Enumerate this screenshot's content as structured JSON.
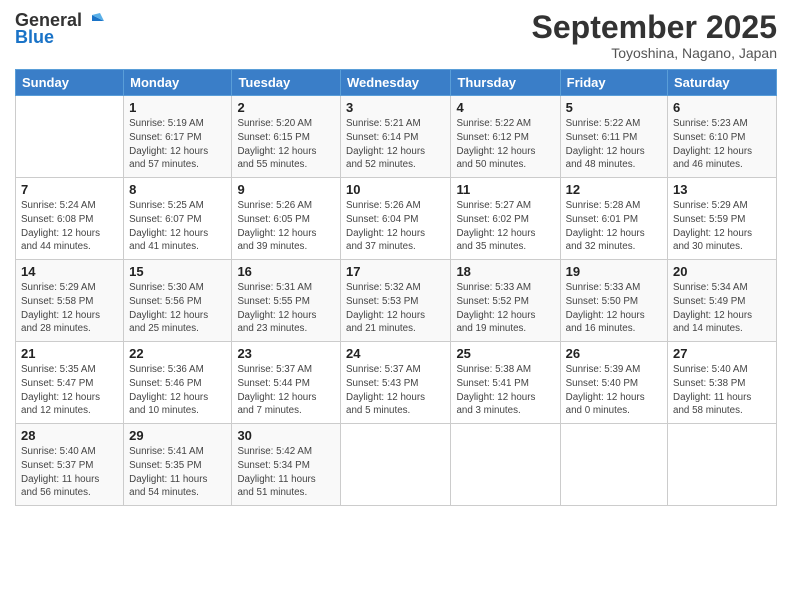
{
  "header": {
    "logo_line1": "General",
    "logo_line2": "Blue",
    "month": "September 2025",
    "location": "Toyoshina, Nagano, Japan"
  },
  "days_of_week": [
    "Sunday",
    "Monday",
    "Tuesday",
    "Wednesday",
    "Thursday",
    "Friday",
    "Saturday"
  ],
  "weeks": [
    [
      {
        "num": "",
        "info": ""
      },
      {
        "num": "1",
        "info": "Sunrise: 5:19 AM\nSunset: 6:17 PM\nDaylight: 12 hours\nand 57 minutes."
      },
      {
        "num": "2",
        "info": "Sunrise: 5:20 AM\nSunset: 6:15 PM\nDaylight: 12 hours\nand 55 minutes."
      },
      {
        "num": "3",
        "info": "Sunrise: 5:21 AM\nSunset: 6:14 PM\nDaylight: 12 hours\nand 52 minutes."
      },
      {
        "num": "4",
        "info": "Sunrise: 5:22 AM\nSunset: 6:12 PM\nDaylight: 12 hours\nand 50 minutes."
      },
      {
        "num": "5",
        "info": "Sunrise: 5:22 AM\nSunset: 6:11 PM\nDaylight: 12 hours\nand 48 minutes."
      },
      {
        "num": "6",
        "info": "Sunrise: 5:23 AM\nSunset: 6:10 PM\nDaylight: 12 hours\nand 46 minutes."
      }
    ],
    [
      {
        "num": "7",
        "info": "Sunrise: 5:24 AM\nSunset: 6:08 PM\nDaylight: 12 hours\nand 44 minutes."
      },
      {
        "num": "8",
        "info": "Sunrise: 5:25 AM\nSunset: 6:07 PM\nDaylight: 12 hours\nand 41 minutes."
      },
      {
        "num": "9",
        "info": "Sunrise: 5:26 AM\nSunset: 6:05 PM\nDaylight: 12 hours\nand 39 minutes."
      },
      {
        "num": "10",
        "info": "Sunrise: 5:26 AM\nSunset: 6:04 PM\nDaylight: 12 hours\nand 37 minutes."
      },
      {
        "num": "11",
        "info": "Sunrise: 5:27 AM\nSunset: 6:02 PM\nDaylight: 12 hours\nand 35 minutes."
      },
      {
        "num": "12",
        "info": "Sunrise: 5:28 AM\nSunset: 6:01 PM\nDaylight: 12 hours\nand 32 minutes."
      },
      {
        "num": "13",
        "info": "Sunrise: 5:29 AM\nSunset: 5:59 PM\nDaylight: 12 hours\nand 30 minutes."
      }
    ],
    [
      {
        "num": "14",
        "info": "Sunrise: 5:29 AM\nSunset: 5:58 PM\nDaylight: 12 hours\nand 28 minutes."
      },
      {
        "num": "15",
        "info": "Sunrise: 5:30 AM\nSunset: 5:56 PM\nDaylight: 12 hours\nand 25 minutes."
      },
      {
        "num": "16",
        "info": "Sunrise: 5:31 AM\nSunset: 5:55 PM\nDaylight: 12 hours\nand 23 minutes."
      },
      {
        "num": "17",
        "info": "Sunrise: 5:32 AM\nSunset: 5:53 PM\nDaylight: 12 hours\nand 21 minutes."
      },
      {
        "num": "18",
        "info": "Sunrise: 5:33 AM\nSunset: 5:52 PM\nDaylight: 12 hours\nand 19 minutes."
      },
      {
        "num": "19",
        "info": "Sunrise: 5:33 AM\nSunset: 5:50 PM\nDaylight: 12 hours\nand 16 minutes."
      },
      {
        "num": "20",
        "info": "Sunrise: 5:34 AM\nSunset: 5:49 PM\nDaylight: 12 hours\nand 14 minutes."
      }
    ],
    [
      {
        "num": "21",
        "info": "Sunrise: 5:35 AM\nSunset: 5:47 PM\nDaylight: 12 hours\nand 12 minutes."
      },
      {
        "num": "22",
        "info": "Sunrise: 5:36 AM\nSunset: 5:46 PM\nDaylight: 12 hours\nand 10 minutes."
      },
      {
        "num": "23",
        "info": "Sunrise: 5:37 AM\nSunset: 5:44 PM\nDaylight: 12 hours\nand 7 minutes."
      },
      {
        "num": "24",
        "info": "Sunrise: 5:37 AM\nSunset: 5:43 PM\nDaylight: 12 hours\nand 5 minutes."
      },
      {
        "num": "25",
        "info": "Sunrise: 5:38 AM\nSunset: 5:41 PM\nDaylight: 12 hours\nand 3 minutes."
      },
      {
        "num": "26",
        "info": "Sunrise: 5:39 AM\nSunset: 5:40 PM\nDaylight: 12 hours\nand 0 minutes."
      },
      {
        "num": "27",
        "info": "Sunrise: 5:40 AM\nSunset: 5:38 PM\nDaylight: 11 hours\nand 58 minutes."
      }
    ],
    [
      {
        "num": "28",
        "info": "Sunrise: 5:40 AM\nSunset: 5:37 PM\nDaylight: 11 hours\nand 56 minutes."
      },
      {
        "num": "29",
        "info": "Sunrise: 5:41 AM\nSunset: 5:35 PM\nDaylight: 11 hours\nand 54 minutes."
      },
      {
        "num": "30",
        "info": "Sunrise: 5:42 AM\nSunset: 5:34 PM\nDaylight: 11 hours\nand 51 minutes."
      },
      {
        "num": "",
        "info": ""
      },
      {
        "num": "",
        "info": ""
      },
      {
        "num": "",
        "info": ""
      },
      {
        "num": "",
        "info": ""
      }
    ]
  ]
}
